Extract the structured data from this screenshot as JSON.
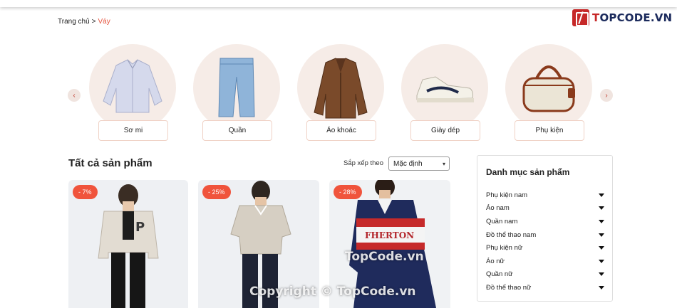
{
  "breadcrumb": {
    "home": "Trang chủ",
    "separator": ">",
    "current": "Váy"
  },
  "logo": {
    "prefix": "T",
    "text": "OPCODE.VN"
  },
  "categories": [
    {
      "label": "Sơ mi",
      "icon": "shirt-icon"
    },
    {
      "label": "Quần",
      "icon": "jeans-icon"
    },
    {
      "label": "Áo khoác",
      "icon": "jacket-icon"
    },
    {
      "label": "Giày dép",
      "icon": "sneaker-icon"
    },
    {
      "label": "Phụ kiện",
      "icon": "handbag-icon"
    }
  ],
  "carousel": {
    "prev": "‹",
    "next": "›"
  },
  "products_section": {
    "title": "Tất cả sản phẩm",
    "sort_label": "Sắp xếp theo",
    "sort_value": "Mặc định"
  },
  "products": [
    {
      "discount": "- 7%"
    },
    {
      "discount": "- 25%"
    },
    {
      "discount": "- 28%"
    }
  ],
  "sidebar": {
    "title": "Danh mục sản phẩm",
    "items": [
      "Phụ kiện nam",
      "Áo nam",
      "Quần nam",
      "Đồ thể thao nam",
      "Phụ kiện nữ",
      "Áo nữ",
      "Quần nữ",
      "Đồ thể thao nữ"
    ]
  },
  "watermarks": {
    "line1": "TopCode.vn",
    "line2": "Copyright © TopCode.vn"
  },
  "colors": {
    "accent": "#f0543c",
    "breadcrumb_current": "#e5533d",
    "category_bg": "#f6ece7",
    "brand_red": "#c62828"
  }
}
